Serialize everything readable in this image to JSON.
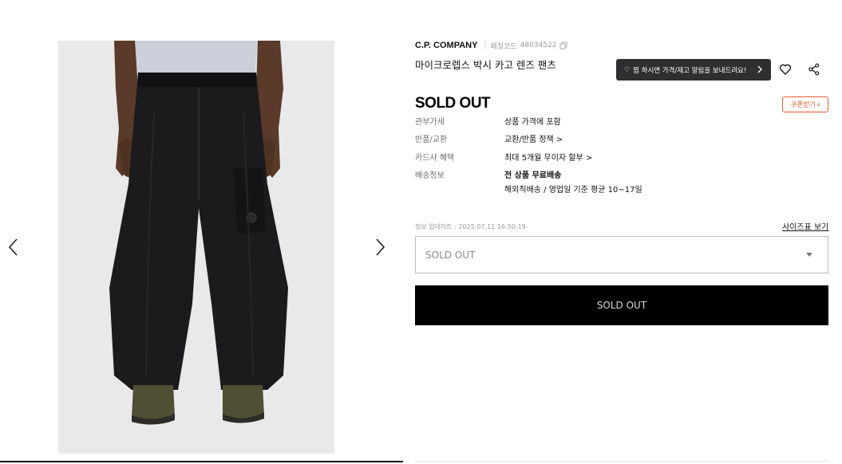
{
  "gallery": {
    "image_alt": "C.P. COMPANY 마이크로렙스 박시 카고 렌즈 팬츠",
    "prev_icon": "chevron-left-icon",
    "next_icon": "chevron-right-icon"
  },
  "product": {
    "brand": "C.P. COMPANY",
    "code_label": "페칭코드",
    "code": "48034522",
    "name": "마이크로렙스 박시 카고 렌즈 팬츠",
    "status": "SOLD OUT"
  },
  "actions": {
    "alert_label": "찜 하시면 가격/재고 알림을 보내드려요!",
    "coupon_label": "쿠폰받기",
    "like_icon": "heart-icon",
    "share_icon": "share-icon"
  },
  "info": {
    "rows": [
      {
        "label": "관부가세",
        "value": "상품 가격에 포함"
      },
      {
        "label": "반품/교환",
        "value": "교환/반품 정책 >"
      },
      {
        "label": "카드사 혜택",
        "value": "최대 5개월 무이자 할부 >"
      },
      {
        "label": "배송정보",
        "value": "전 상품 무료배송"
      }
    ],
    "shipping_detail": "해외직배송 / 영업일 기준 평균 10~17일"
  },
  "update_text": "정보 업데이트 : 2025.07.11 16:50:19",
  "size_guide_label": "사이즈표 보기",
  "option_select": {
    "selected": "SOLD OUT"
  },
  "cta": {
    "label": "SOLD OUT"
  },
  "colors": {
    "accent": "#e35a2a",
    "dark_button": "#2f2f31",
    "primary_button": "#000000",
    "photo_bg": "#e9e9ea"
  }
}
